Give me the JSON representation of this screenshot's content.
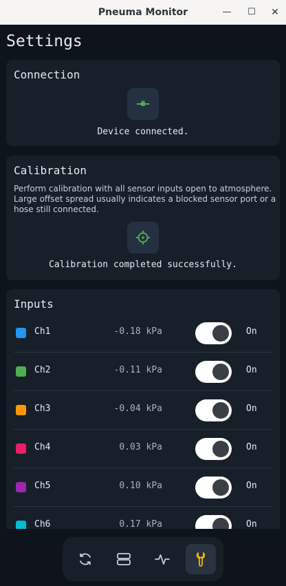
{
  "window": {
    "title": "Pneuma Monitor",
    "min_glyph": "—",
    "max_glyph": "☐",
    "close_glyph": "✕"
  },
  "page": {
    "title": "Settings"
  },
  "connection": {
    "title": "Connection",
    "icon": "plug-connected-icon",
    "status": "Device connected."
  },
  "calibration": {
    "title": "Calibration",
    "description": "Perform calibration with all sensor inputs open to atmosphere. Large offset spread usually indicates a blocked sensor port or a hose still connected.",
    "icon": "crosshair-icon",
    "status": "Calibration completed successfully."
  },
  "inputs": {
    "title": "Inputs",
    "channels": [
      {
        "name": "Ch1",
        "value": "-0.18 kPa",
        "state": "On",
        "color": "#2196f3",
        "enabled": true
      },
      {
        "name": "Ch2",
        "value": "-0.11 kPa",
        "state": "On",
        "color": "#4caf50",
        "enabled": true
      },
      {
        "name": "Ch3",
        "value": "-0.04 kPa",
        "state": "On",
        "color": "#ff9800",
        "enabled": true
      },
      {
        "name": "Ch4",
        "value": "0.03 kPa",
        "state": "On",
        "color": "#e91e63",
        "enabled": true
      },
      {
        "name": "Ch5",
        "value": "0.10 kPa",
        "state": "On",
        "color": "#9c27b0",
        "enabled": true
      },
      {
        "name": "Ch6",
        "value": "0.17 kPa",
        "state": "On",
        "color": "#00bcd4",
        "enabled": true
      }
    ]
  },
  "nav": {
    "items": [
      {
        "icon": "refresh-icon",
        "active": false
      },
      {
        "icon": "layout-rows-icon",
        "active": false
      },
      {
        "icon": "waveform-icon",
        "active": false
      },
      {
        "icon": "wrench-icon",
        "active": true
      }
    ]
  },
  "colors": {
    "accent": "#f5b800",
    "success": "#4caf50",
    "background": "#0e141c",
    "card": "#172029"
  }
}
